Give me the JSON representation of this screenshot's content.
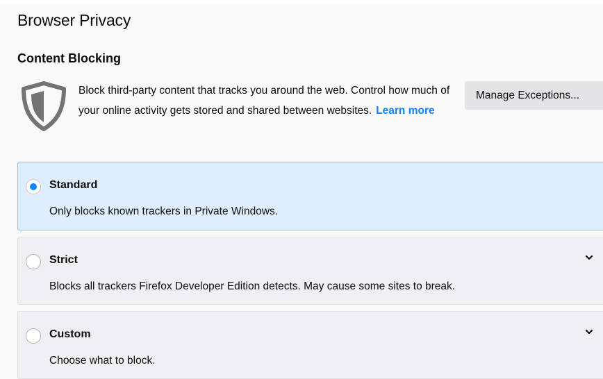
{
  "page": {
    "title": "Browser Privacy"
  },
  "content_blocking": {
    "heading": "Content Blocking",
    "description": "Block third-party content that tracks you around the web. Control how much of your online activity gets stored and shared between websites.",
    "learn_more": "Learn more",
    "manage_exceptions": "Manage Exceptions..."
  },
  "options": [
    {
      "label": "Standard",
      "description": "Only blocks known trackers in Private Windows.",
      "selected": true
    },
    {
      "label": "Strict",
      "description": "Blocks all trackers Firefox Developer Edition detects. May cause some sites to break.",
      "selected": false
    },
    {
      "label": "Custom",
      "description": "Choose what to block.",
      "selected": false
    }
  ],
  "icons": {
    "shield": "shield-icon",
    "expand": "chevron-down-icon"
  },
  "colors": {
    "accent": "#0a84ff",
    "selected_background": "#deeeff",
    "selected_border": "#8cc2f6",
    "option_background": "#f0f0f4",
    "button_background": "#e4e4e6",
    "shield": "#737373"
  }
}
